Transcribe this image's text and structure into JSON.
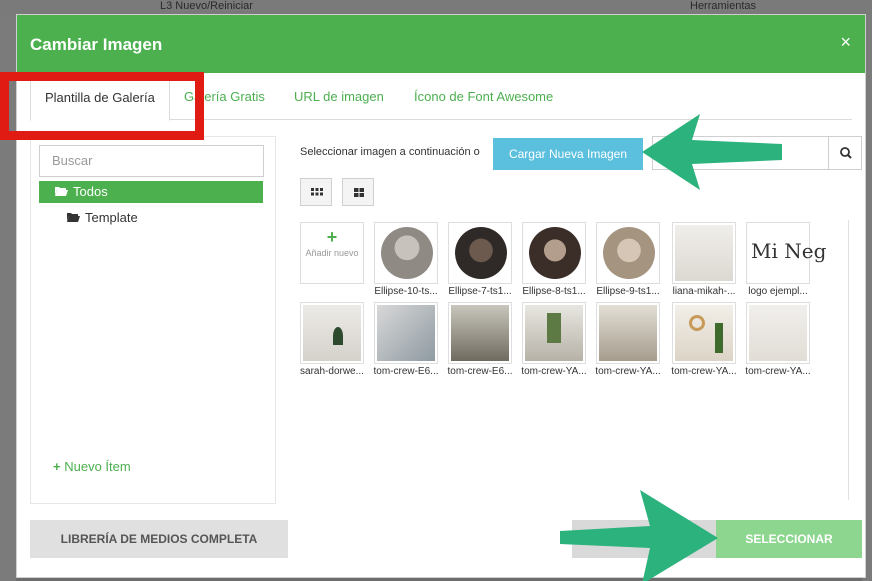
{
  "background": {
    "top_items": [
      "L3 Nuevo/Reiniciar",
      "Herramientas"
    ]
  },
  "modal": {
    "title": "Cambiar Imagen",
    "close_label": "×",
    "accent_color": "#4cb04f"
  },
  "tabs": [
    {
      "label": "Plantilla de Galería",
      "active": true
    },
    {
      "label": "Galería Gratis",
      "active": false
    },
    {
      "label": "URL de imagen",
      "active": false
    },
    {
      "label": "Ícono de Font Awesome",
      "active": false
    }
  ],
  "left_panel": {
    "search_placeholder": "Buscar",
    "folders": [
      {
        "label": "Todos",
        "active": true
      },
      {
        "label": "Template",
        "active": false
      }
    ],
    "new_item_label": "Nuevo Ítem"
  },
  "toolbar": {
    "select_text": "Seleccionar imagen a continuación o",
    "upload_label": "Cargar Nueva Imagen",
    "search_icon": "search-icon"
  },
  "gallery": {
    "add_new_label": "Añadir nuevo",
    "row1": [
      {
        "label": "Ellipse-10-ts..."
      },
      {
        "label": "Ellipse-7-ts1..."
      },
      {
        "label": "Ellipse-8-ts1..."
      },
      {
        "label": "Ellipse-9-ts1..."
      },
      {
        "label": "liana-mikah-..."
      },
      {
        "label": "logo ejempl...",
        "logo_text": "Mi Neg"
      }
    ],
    "row2": [
      {
        "label": "sarah-dorwe..."
      },
      {
        "label": "tom-crew-E6..."
      },
      {
        "label": "tom-crew-E6..."
      },
      {
        "label": "tom-crew-YA..."
      },
      {
        "label": "tom-crew-YA..."
      },
      {
        "label": "tom-crew-YA..."
      },
      {
        "label": "tom-crew-YA..."
      }
    ]
  },
  "footer": {
    "library_label": "LIBRERÍA DE MEDIOS COMPLETA",
    "select_label": "SELECCIONAR"
  }
}
